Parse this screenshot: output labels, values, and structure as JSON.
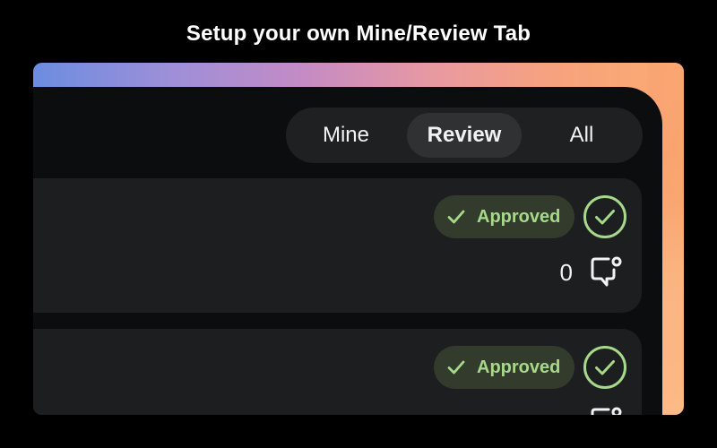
{
  "heading": "Setup your own Mine/Review Tab",
  "tabs": [
    {
      "label": "Mine",
      "selected": false
    },
    {
      "label": "Review",
      "selected": true
    },
    {
      "label": "All",
      "selected": false
    }
  ],
  "cards": [
    {
      "status": "Approved",
      "comment_count": "0"
    },
    {
      "status": "Approved",
      "comment_count": ""
    }
  ],
  "colors": {
    "background": "#000000",
    "card": "#1d1e20",
    "approved_text": "#a6d98a",
    "approved_badge": "#323b2c",
    "segmented_bg": "#1f2022",
    "segmented_active": "#303133"
  },
  "icons": {
    "approved_badge": "check-icon",
    "status": "check-circle-icon",
    "comments": "comment-icon"
  }
}
